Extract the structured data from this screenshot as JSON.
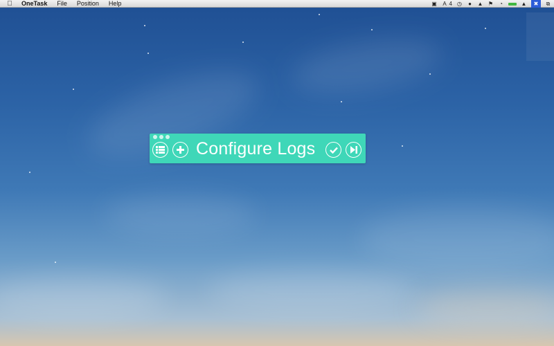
{
  "menubar": {
    "apple_icon": "apple-logo-icon",
    "app_name": "OneTask",
    "items": [
      "File",
      "Position",
      "Help"
    ],
    "status_icons": [
      "screen-icon",
      "adobe-icon",
      "clock-icon",
      "chat-icon",
      "drive-icon",
      "flag-icon",
      "timer-icon",
      "battery-icon",
      "hat-icon",
      "onetask-icon",
      "window-icon"
    ],
    "status_count": "4"
  },
  "widget": {
    "accent_color": "#3fd7b8",
    "task_text": "Configure Logs",
    "buttons": {
      "list": "list-icon",
      "add": "plus-icon",
      "complete": "check-icon",
      "skip": "skip-next-icon"
    }
  }
}
